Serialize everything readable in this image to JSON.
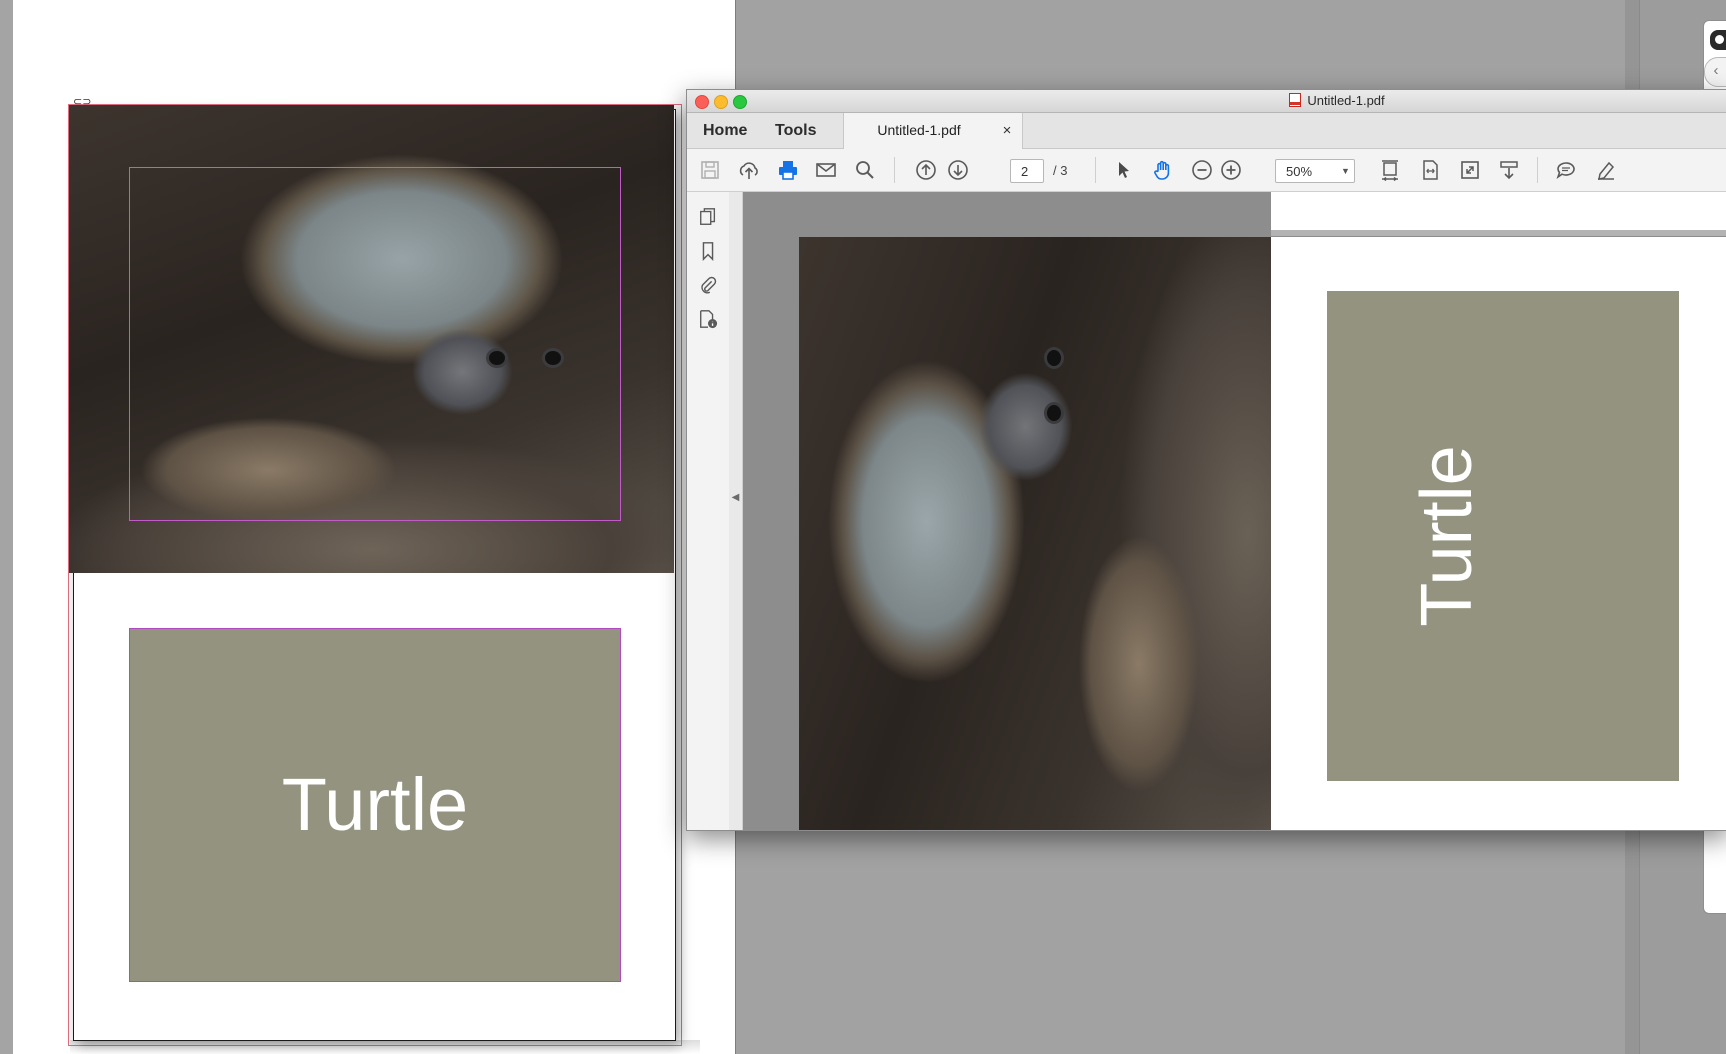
{
  "indesign": {
    "layout_label": "Turtle"
  },
  "pdf_viewer": {
    "window_title": "Untitled-1.pdf",
    "tabs": {
      "home": "Home",
      "tools": "Tools"
    },
    "document_tab": {
      "label": "Untitled-1.pdf",
      "close": "×"
    },
    "toolbar": {
      "current_page": "2",
      "page_total": "/ 3",
      "zoom": "50%",
      "hand_tool_active_color": "#1473e6"
    },
    "document": {
      "page_label": "Turtle"
    }
  },
  "colors": {
    "accent_gray_box": "#93937f",
    "frame_magenta": "#c35ac9",
    "bleed_red": "#e06f80"
  },
  "icons": [
    "save-icon",
    "upload-icon",
    "print-icon",
    "email-icon",
    "search-icon",
    "previous-page-icon",
    "next-page-icon",
    "select-cursor-icon",
    "hand-tool-icon",
    "zoom-out-icon",
    "zoom-in-icon",
    "fit-page-icon",
    "fit-width-icon",
    "full-screen-icon",
    "scroll-mode-icon",
    "comment-icon",
    "highlight-pen-icon",
    "pages-panel-icon",
    "bookmark-icon",
    "attachment-icon",
    "document-info-icon",
    "link-icon"
  ]
}
